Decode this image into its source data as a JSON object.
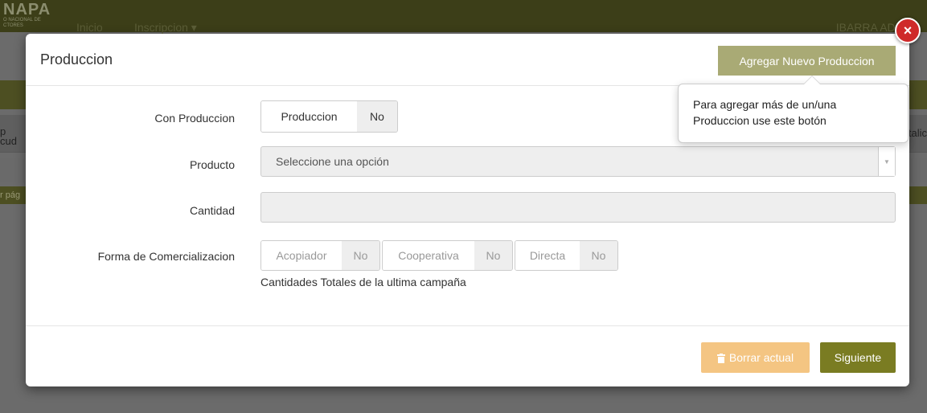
{
  "background": {
    "logo_text": "NAPA",
    "logo_sub": "O NACIONAL DE CTORES",
    "nav_home": "Inicio",
    "nav_inscription": "Inscripcion ▾",
    "user": "IBARRA ADE",
    "left_text_1": "p",
    "left_text_2": "cud",
    "left_text_3": "r pág",
    "right_text": "talic"
  },
  "modal": {
    "title": "Produccion",
    "add_button": "Agregar Nuevo Produccion",
    "close_icon": "×",
    "tooltip": "Para agregar más de un/una Produccion use este botón"
  },
  "form": {
    "con_produccion": {
      "label": "Con Produccion",
      "on": "Produccion",
      "off": "No"
    },
    "producto": {
      "label": "Producto",
      "placeholder": "Seleccione una opción"
    },
    "cantidad": {
      "label": "Cantidad",
      "value": ""
    },
    "forma": {
      "label": "Forma de Comercializacion",
      "options": [
        {
          "on": "Acopiador",
          "off": "No"
        },
        {
          "on": "Cooperativa",
          "off": "No"
        },
        {
          "on": "Directa",
          "off": "No"
        }
      ],
      "help": "Cantidades Totales de la ultima campaña"
    }
  },
  "footer": {
    "delete_button": "Borrar actual",
    "next_button": "Siguiente"
  },
  "colors": {
    "brand_olive": "#7a7c22",
    "add_button": "#a9aa75",
    "delete_button": "#f0ad4e",
    "close": "#cf2a2a"
  }
}
